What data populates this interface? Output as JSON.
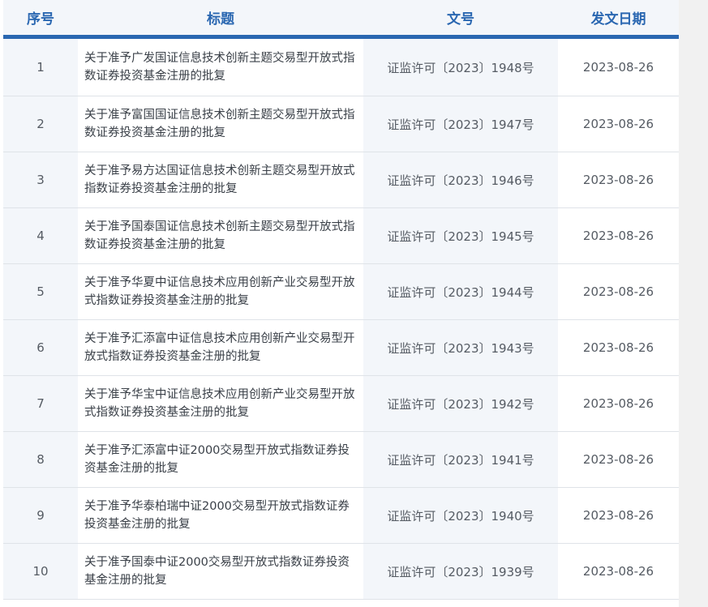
{
  "table": {
    "headers": {
      "index": "序号",
      "title": "标题",
      "doc_no": "文号",
      "date": "发文日期"
    },
    "rows": [
      {
        "index": "1",
        "title": "关于准予广发国证信息技术创新主题交易型开放式指数证券投资基金注册的批复",
        "doc_no": "证监许可〔2023〕1948号",
        "date": "2023-08-26"
      },
      {
        "index": "2",
        "title": "关于准予富国国证信息技术创新主题交易型开放式指数证券投资基金注册的批复",
        "doc_no": "证监许可〔2023〕1947号",
        "date": "2023-08-26"
      },
      {
        "index": "3",
        "title": "关于准予易方达国证信息技术创新主题交易型开放式指数证券投资基金注册的批复",
        "doc_no": "证监许可〔2023〕1946号",
        "date": "2023-08-26"
      },
      {
        "index": "4",
        "title": "关于准予国泰国证信息技术创新主题交易型开放式指数证券投资基金注册的批复",
        "doc_no": "证监许可〔2023〕1945号",
        "date": "2023-08-26"
      },
      {
        "index": "5",
        "title": "关于准予华夏中证信息技术应用创新产业交易型开放式指数证券投资基金注册的批复",
        "doc_no": "证监许可〔2023〕1944号",
        "date": "2023-08-26"
      },
      {
        "index": "6",
        "title": "关于准予汇添富中证信息技术应用创新产业交易型开放式指数证券投资基金注册的批复",
        "doc_no": "证监许可〔2023〕1943号",
        "date": "2023-08-26"
      },
      {
        "index": "7",
        "title": "关于准予华宝中证信息技术应用创新产业交易型开放式指数证券投资基金注册的批复",
        "doc_no": "证监许可〔2023〕1942号",
        "date": "2023-08-26"
      },
      {
        "index": "8",
        "title": "关于准予汇添富中证2000交易型开放式指数证券投资基金注册的批复",
        "doc_no": "证监许可〔2023〕1941号",
        "date": "2023-08-26"
      },
      {
        "index": "9",
        "title": "关于准予华泰柏瑞中证2000交易型开放式指数证券投资基金注册的批复",
        "doc_no": "证监许可〔2023〕1940号",
        "date": "2023-08-26"
      },
      {
        "index": "10",
        "title": "关于准予国泰中证2000交易型开放式指数证券投资基金注册的批复",
        "doc_no": "证监许可〔2023〕1939号",
        "date": "2023-08-26"
      }
    ]
  },
  "colors": {
    "header_text": "#2a67b1",
    "header_rule": "#2a67b1",
    "header_bg": "#f3f6fa",
    "alt_col_bg": "#f3f6fa",
    "row_divider": "#dfe3e8",
    "scroll_gutter": "#f1f1f1"
  }
}
